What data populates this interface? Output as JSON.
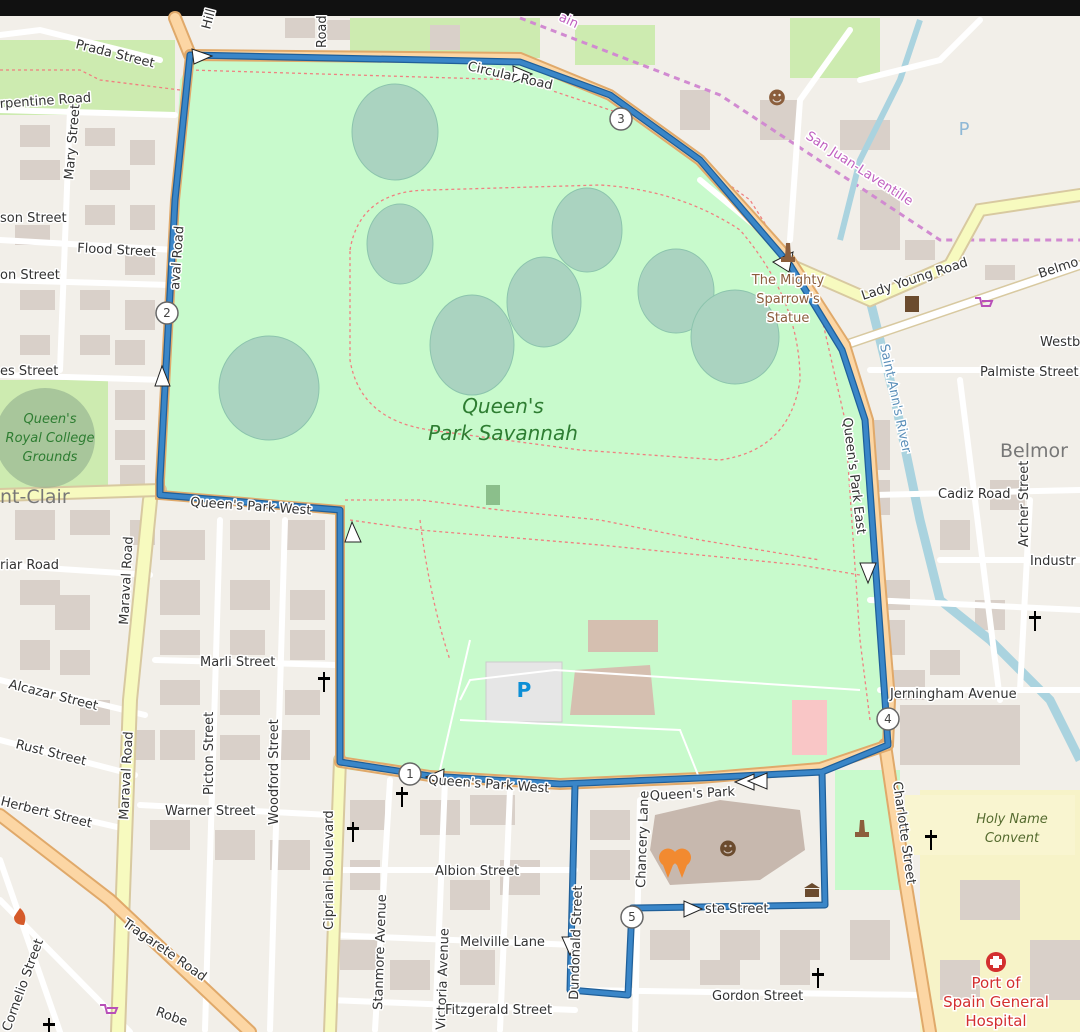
{
  "map": {
    "park_name_line1": "Queen's",
    "park_name_line2": "Park Savannah",
    "royal_college_line1": "Queen's",
    "royal_college_line2": "Royal College",
    "royal_college_line3": "Grounds",
    "area_st_clair": "nt-Clair",
    "area_belmont": "Belmor",
    "parking_symbol": "P",
    "poi_sparrow_line1": "The Mighty",
    "poi_sparrow_line2": "Sparrow's",
    "poi_sparrow_line3": "Statue",
    "hospital_line1": "Port of",
    "hospital_line2": "Spain General",
    "hospital_line3": "Hospital",
    "convent_line1": "Holy Name",
    "convent_line2": "Convent",
    "rail_san_juan": "San Juan-Laventille",
    "rail_top": "ain",
    "river_name": "Saint Ann's River"
  },
  "streets": {
    "prada": "Prada Street",
    "serpentine": "rpentine Road",
    "mary": "Mary Street",
    "son": "son Street",
    "flood": "Flood Street",
    "on": "on Street",
    "es": "es Street",
    "maraval_north": "aval Road",
    "hill": "Hill",
    "road_top": "Road",
    "circular": "Circular Road",
    "lady_young": "Lady Young Road",
    "belmo": "Belmo",
    "westb": "Westb",
    "palmiste": "Palmiste Street",
    "cadiz": "Cadiz Road",
    "archer": "Archer Street",
    "industr": "Industr",
    "qp_east": "Queen's Park East",
    "jerningham": "Jerningham Avenue",
    "charlotte": "Charlotte Street",
    "qp_west_mid": "Queen's Park West",
    "qp_west_south": "Queen's Park West",
    "qp_south": "Queen's Park",
    "friar": "riar Road",
    "maraval": "Maraval Road",
    "marli": "Marli Street",
    "alcazar": "Alcazar Street",
    "rust": "Rust Street",
    "herbert": "Herbert Street",
    "warner": "Warner Street",
    "picton": "Picton Street",
    "woodford": "Woodford Street",
    "cipriani": "Cipriani Boulevard",
    "albion": "Albion Street",
    "stanmore": "Stanmore Avenue",
    "victoria": "Victoria Avenue",
    "melville": "Melville Lane",
    "dundonald": "Dundonald Street",
    "chancery": "Chancery Lane",
    "ste": "ste Street",
    "gordon": "Gordon Street",
    "fitzgerald": "Fitzgerald Street",
    "tragarete": "Tragarete Road",
    "cornelio": "Cornelio Street",
    "robe": "Robe"
  },
  "route": {
    "color": "#3a86c8",
    "waypoints": [
      "1",
      "2",
      "3",
      "4",
      "5"
    ]
  },
  "colors": {
    "park": "#c8facc",
    "water_trees": "#aad3c0",
    "major_road": "#fcd6a4",
    "secondary_road": "#f7fabf",
    "hospital": "#d32f2f"
  },
  "icons": [
    "theatre-icon",
    "church-icon",
    "statue-icon",
    "hospital-icon",
    "shop-icon",
    "fire-station-icon",
    "museum-icon",
    "bar-icon",
    "parking-icon"
  ]
}
